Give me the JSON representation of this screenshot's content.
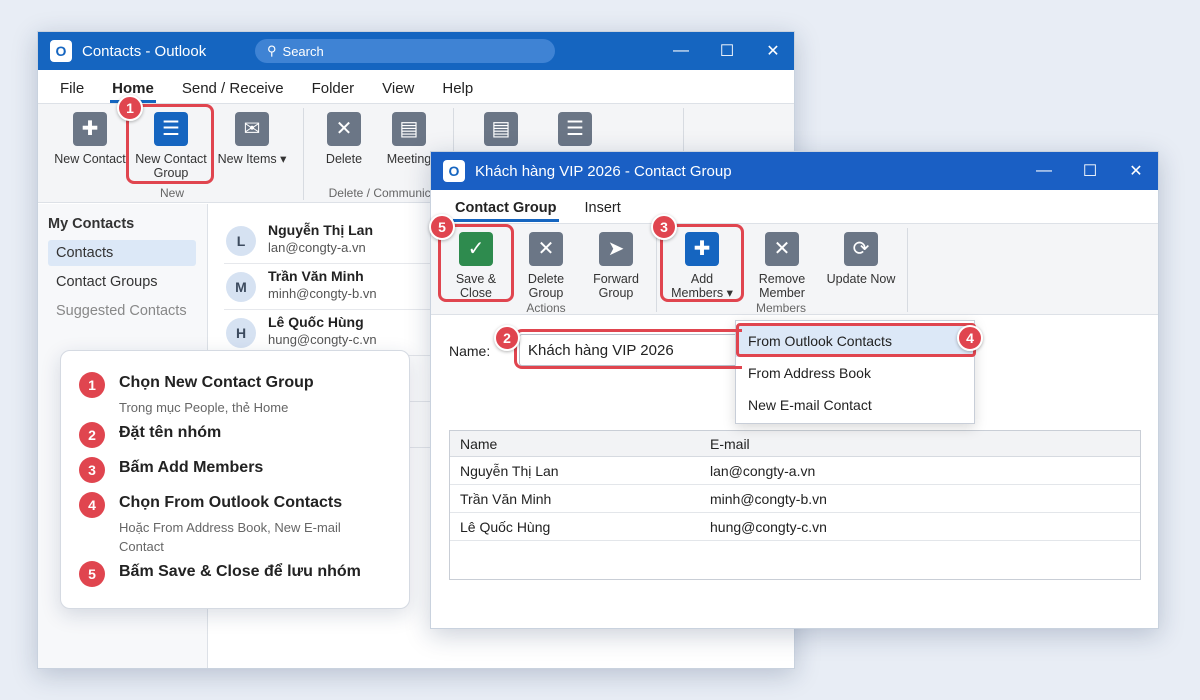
{
  "outlook": {
    "title": "Contacts - Outlook",
    "logo": "O",
    "search_placeholder": "Search",
    "controls": {
      "minimize": "—",
      "maximize": "☐",
      "close": "✕"
    },
    "menu": [
      "File",
      "Home",
      "Send / Receive",
      "Folder",
      "View",
      "Help"
    ],
    "ribbon": {
      "new_contact": "New Contact",
      "new_contact_group": "New Contact Group",
      "new_items": "New Items ▾",
      "group_new": "New",
      "delete": "Delete",
      "meeting": "Meeting",
      "group_delete": "Delete / Communicate"
    },
    "sidebar": {
      "heading": "My Contacts",
      "items": [
        "Contacts",
        "Contact Groups",
        "Suggested Contacts"
      ]
    },
    "contacts": [
      {
        "initial": "L",
        "name": "Nguyễn Thị Lan",
        "email": "lan@congty-a.vn"
      },
      {
        "initial": "M",
        "name": "Trần Văn Minh",
        "email": "minh@congty-b.vn"
      },
      {
        "initial": "H",
        "name": "Lê Quốc Hùng",
        "email": "hung@congty-c.vn"
      }
    ]
  },
  "group_window": {
    "title": "Khách hàng VIP 2026 - Contact Group",
    "logo": "O",
    "controls": {
      "minimize": "—",
      "maximize": "☐",
      "close": "✕"
    },
    "tabs": [
      "Contact Group",
      "Insert"
    ],
    "ribbon": {
      "save_close": "Save & Close",
      "delete_group": "Delete Group",
      "forward_group": "Forward Group",
      "group_actions": "Actions",
      "add_members": "Add Members ▾",
      "remove_member": "Remove Member",
      "update_now": "Update Now",
      "group_members": "Members"
    },
    "name_label": "Name:",
    "name_value": "Khách hàng VIP 2026",
    "dropdown": [
      "From Outlook Contacts",
      "From Address Book",
      "New E-mail Contact"
    ],
    "table": {
      "headers": [
        "Name",
        "E-mail"
      ],
      "rows": [
        [
          "Nguyễn Thị Lan",
          "lan@congty-a.vn"
        ],
        [
          "Trần Văn Minh",
          "minh@congty-b.vn"
        ],
        [
          "Lê Quốc Hùng",
          "hung@congty-c.vn"
        ]
      ]
    }
  },
  "badges": [
    "1",
    "2",
    "3",
    "4",
    "5"
  ],
  "steps": [
    {
      "num": "1",
      "title": "Chọn New Contact Group",
      "sub": "Trong mục People, thẻ Home"
    },
    {
      "num": "2",
      "title": "Đặt tên nhóm",
      "sub": ""
    },
    {
      "num": "3",
      "title": "Bấm Add Members",
      "sub": ""
    },
    {
      "num": "4",
      "title": "Chọn From Outlook Contacts",
      "sub": "Hoặc From Address Book, New E-mail Contact"
    },
    {
      "num": "5",
      "title": "Bấm Save & Close để lưu nhóm",
      "sub": ""
    }
  ],
  "colors": {
    "accent": "#1565c0",
    "highlight": "#e0454f",
    "save_green": "#2e8b4e"
  }
}
